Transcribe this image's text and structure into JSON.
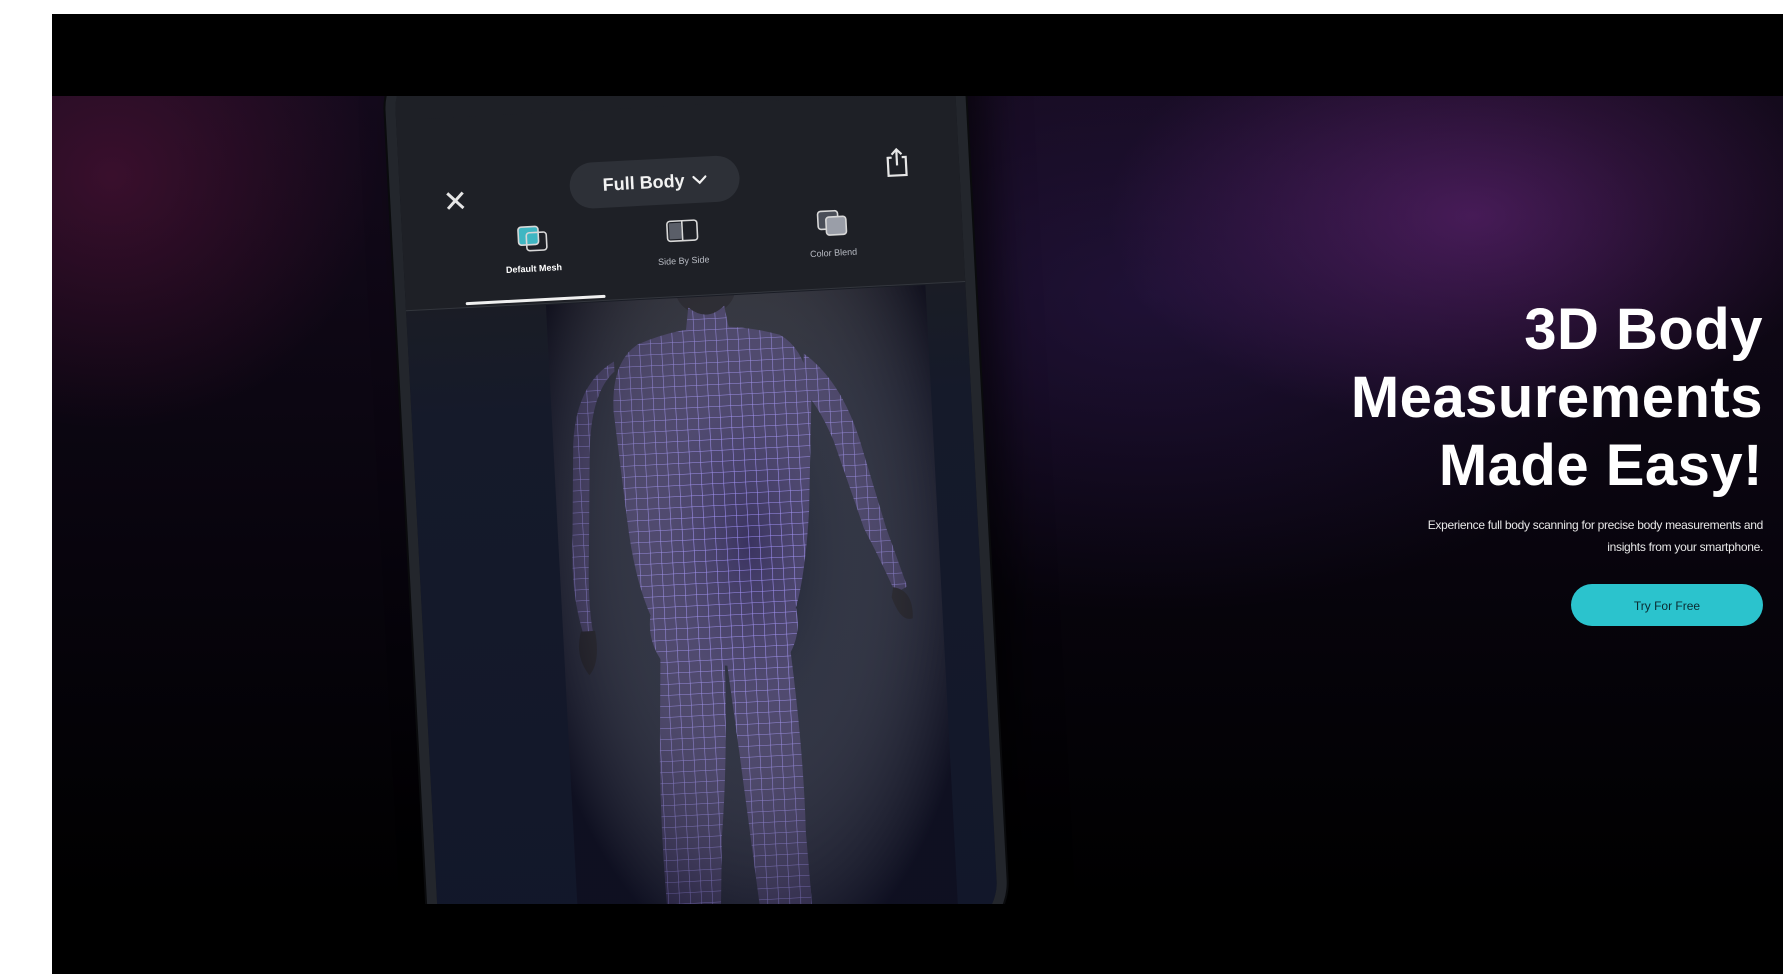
{
  "phone": {
    "view_selector": "Full Body",
    "tabs": [
      {
        "label": "Default Mesh",
        "active": true
      },
      {
        "label": "Side By Side",
        "active": false
      },
      {
        "label": "Color Blend",
        "active": false
      }
    ]
  },
  "hero": {
    "headline_line1": "3D Body",
    "headline_line2": "Measurements",
    "headline_line3": "Made Easy!",
    "subtext_line1": "Experience full body scanning for precise body measurements and",
    "subtext_line2": "insights from your smartphone.",
    "cta_label": "Try For Free"
  },
  "colors": {
    "accent": "#2bc3cd",
    "mesh": "#8a78e8",
    "background": "#000000"
  },
  "icons": {
    "close": "close-icon",
    "share": "share-icon",
    "dropdown": "chevron-down-icon"
  }
}
